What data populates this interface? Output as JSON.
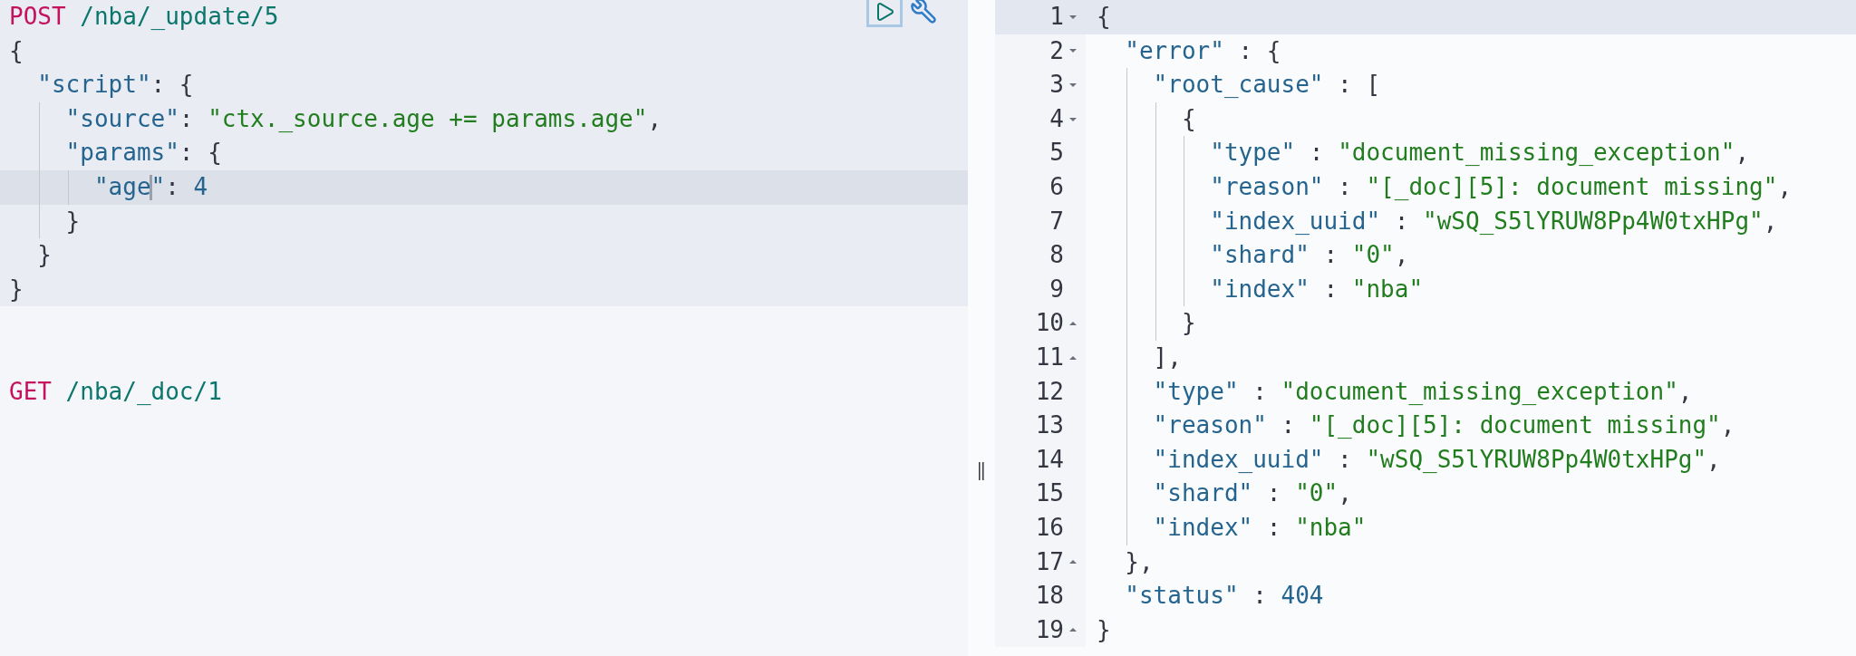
{
  "request_editor": {
    "requests": [
      {
        "selected": true,
        "lines": [
          {
            "active": false,
            "tokens": [
              {
                "kind": "method",
                "t": "POST"
              },
              {
                "kind": "url",
                "t": " /nba/_update/5"
              }
            ]
          },
          {
            "active": false,
            "tokens": [
              {
                "kind": "punct",
                "t": "{"
              }
            ]
          },
          {
            "active": false,
            "tokens": [
              {
                "kind": "key",
                "t": "  \"script\""
              },
              {
                "kind": "punct",
                "t": ": {"
              }
            ]
          },
          {
            "active": false,
            "tokens": [
              {
                "kind": "key",
                "t": "    \"source\""
              },
              {
                "kind": "punct",
                "t": ": "
              },
              {
                "kind": "string",
                "t": "\"ctx._source.age += params.age\""
              },
              {
                "kind": "punct",
                "t": ","
              }
            ]
          },
          {
            "active": false,
            "tokens": [
              {
                "kind": "key",
                "t": "    \"params\""
              },
              {
                "kind": "punct",
                "t": ": {"
              }
            ]
          },
          {
            "active": true,
            "tokens": [
              {
                "kind": "key",
                "t": "      \"age"
              },
              {
                "kind": "cursor"
              },
              {
                "kind": "key",
                "t": "\""
              },
              {
                "kind": "punct",
                "t": ": "
              },
              {
                "kind": "number",
                "t": "4"
              }
            ]
          },
          {
            "active": false,
            "tokens": [
              {
                "kind": "punct",
                "t": "    }"
              }
            ]
          },
          {
            "active": false,
            "tokens": [
              {
                "kind": "punct",
                "t": "  }"
              }
            ]
          },
          {
            "active": false,
            "tokens": [
              {
                "kind": "punct",
                "t": "}"
              }
            ]
          }
        ]
      },
      {
        "selected": false,
        "lines": [
          {
            "active": false,
            "tokens": [
              {
                "kind": "method",
                "t": "GET"
              },
              {
                "kind": "url",
                "t": " /nba/_doc/1"
              }
            ]
          }
        ]
      }
    ]
  },
  "response_viewer": {
    "lines": [
      {
        "number": "1",
        "kind": "fold_start",
        "active": true,
        "tokens": [
          {
            "kind": "punct",
            "t": "{"
          }
        ]
      },
      {
        "number": "2",
        "kind": "fold_start",
        "active": false,
        "tokens": [
          {
            "kind": "key",
            "t": "  \"error\""
          },
          {
            "kind": "punct",
            "t": " : {"
          }
        ]
      },
      {
        "number": "3",
        "kind": "fold_start",
        "active": false,
        "tokens": [
          {
            "kind": "key",
            "t": "    \"root_cause\""
          },
          {
            "kind": "punct",
            "t": " : ["
          }
        ]
      },
      {
        "number": "4",
        "kind": "fold_start",
        "active": false,
        "tokens": [
          {
            "kind": "punct",
            "t": "      {"
          }
        ]
      },
      {
        "number": "5",
        "kind": "plain",
        "active": false,
        "tokens": [
          {
            "kind": "key",
            "t": "        \"type\""
          },
          {
            "kind": "punct",
            "t": " : "
          },
          {
            "kind": "string",
            "t": "\"document_missing_exception\""
          },
          {
            "kind": "punct",
            "t": ","
          }
        ]
      },
      {
        "number": "6",
        "kind": "plain",
        "active": false,
        "tokens": [
          {
            "kind": "key",
            "t": "        \"reason\""
          },
          {
            "kind": "punct",
            "t": " : "
          },
          {
            "kind": "string",
            "t": "\"[_doc][5]: document missing\""
          },
          {
            "kind": "punct",
            "t": ","
          }
        ]
      },
      {
        "number": "7",
        "kind": "plain",
        "active": false,
        "tokens": [
          {
            "kind": "key",
            "t": "        \"index_uuid\""
          },
          {
            "kind": "punct",
            "t": " : "
          },
          {
            "kind": "string",
            "t": "\"wSQ_S5lYRUW8Pp4W0txHPg\""
          },
          {
            "kind": "punct",
            "t": ","
          }
        ]
      },
      {
        "number": "8",
        "kind": "plain",
        "active": false,
        "tokens": [
          {
            "kind": "key",
            "t": "        \"shard\""
          },
          {
            "kind": "punct",
            "t": " : "
          },
          {
            "kind": "string",
            "t": "\"0\""
          },
          {
            "kind": "punct",
            "t": ","
          }
        ]
      },
      {
        "number": "9",
        "kind": "plain",
        "active": false,
        "tokens": [
          {
            "kind": "key",
            "t": "        \"index\""
          },
          {
            "kind": "punct",
            "t": " : "
          },
          {
            "kind": "string",
            "t": "\"nba\""
          }
        ]
      },
      {
        "number": "10",
        "kind": "fold_end",
        "active": false,
        "tokens": [
          {
            "kind": "punct",
            "t": "      }"
          }
        ]
      },
      {
        "number": "11",
        "kind": "fold_end",
        "active": false,
        "tokens": [
          {
            "kind": "punct",
            "t": "    ],"
          }
        ]
      },
      {
        "number": "12",
        "kind": "plain",
        "active": false,
        "tokens": [
          {
            "kind": "key",
            "t": "    \"type\""
          },
          {
            "kind": "punct",
            "t": " : "
          },
          {
            "kind": "string",
            "t": "\"document_missing_exception\""
          },
          {
            "kind": "punct",
            "t": ","
          }
        ]
      },
      {
        "number": "13",
        "kind": "plain",
        "active": false,
        "tokens": [
          {
            "kind": "key",
            "t": "    \"reason\""
          },
          {
            "kind": "punct",
            "t": " : "
          },
          {
            "kind": "string",
            "t": "\"[_doc][5]: document missing\""
          },
          {
            "kind": "punct",
            "t": ","
          }
        ]
      },
      {
        "number": "14",
        "kind": "plain",
        "active": false,
        "tokens": [
          {
            "kind": "key",
            "t": "    \"index_uuid\""
          },
          {
            "kind": "punct",
            "t": " : "
          },
          {
            "kind": "string",
            "t": "\"wSQ_S5lYRUW8Pp4W0txHPg\""
          },
          {
            "kind": "punct",
            "t": ","
          }
        ]
      },
      {
        "number": "15",
        "kind": "plain",
        "active": false,
        "tokens": [
          {
            "kind": "key",
            "t": "    \"shard\""
          },
          {
            "kind": "punct",
            "t": " : "
          },
          {
            "kind": "string",
            "t": "\"0\""
          },
          {
            "kind": "punct",
            "t": ","
          }
        ]
      },
      {
        "number": "16",
        "kind": "plain",
        "active": false,
        "tokens": [
          {
            "kind": "key",
            "t": "    \"index\""
          },
          {
            "kind": "punct",
            "t": " : "
          },
          {
            "kind": "string",
            "t": "\"nba\""
          }
        ]
      },
      {
        "number": "17",
        "kind": "fold_end",
        "active": false,
        "tokens": [
          {
            "kind": "punct",
            "t": "  },"
          }
        ]
      },
      {
        "number": "18",
        "kind": "plain",
        "active": false,
        "tokens": [
          {
            "kind": "key",
            "t": "  \"status\""
          },
          {
            "kind": "punct",
            "t": " : "
          },
          {
            "kind": "number",
            "t": "404"
          }
        ]
      },
      {
        "number": "19",
        "kind": "fold_end",
        "active": false,
        "tokens": [
          {
            "kind": "punct",
            "t": "}"
          }
        ]
      }
    ]
  }
}
